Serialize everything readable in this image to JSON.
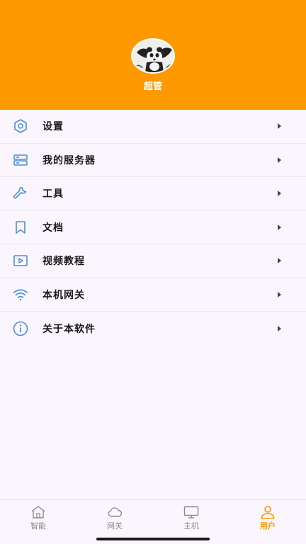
{
  "profile": {
    "username": "超管"
  },
  "menu": {
    "items": [
      {
        "label": "设置",
        "icon": "hexagon-settings-icon"
      },
      {
        "label": "我的服务器",
        "icon": "server-icon"
      },
      {
        "label": "工具",
        "icon": "wrench-icon"
      },
      {
        "label": "文档",
        "icon": "bookmark-icon"
      },
      {
        "label": "视频教程",
        "icon": "video-play-icon"
      },
      {
        "label": "本机网关",
        "icon": "wifi-icon"
      },
      {
        "label": "关于本软件",
        "icon": "info-icon"
      }
    ]
  },
  "tabbar": {
    "tabs": [
      {
        "label": "智能",
        "icon": "home-icon"
      },
      {
        "label": "网关",
        "icon": "cloud-icon"
      },
      {
        "label": "主机",
        "icon": "monitor-icon"
      },
      {
        "label": "用户",
        "icon": "user-icon"
      }
    ],
    "active_index": 3
  },
  "colors": {
    "accent": "#ff9900",
    "icon_blue": "#4a8fd8",
    "background": "#fbf6fd"
  }
}
